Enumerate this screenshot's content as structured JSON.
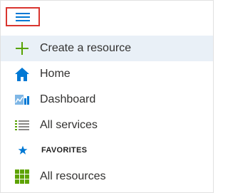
{
  "menu": {
    "toggle_icon": "hamburger-icon",
    "items": [
      {
        "label": "Create a resource",
        "icon": "plus-icon",
        "selected": true
      },
      {
        "label": "Home",
        "icon": "home-icon"
      },
      {
        "label": "Dashboard",
        "icon": "dashboard-icon"
      },
      {
        "label": "All services",
        "icon": "list-icon"
      }
    ],
    "favorites": {
      "header": "FAVORITES",
      "icon": "star-icon",
      "items": [
        {
          "label": "All resources",
          "icon": "grid-icon"
        }
      ]
    }
  },
  "colors": {
    "accent": "#0078d4",
    "plus_green": "#57a300",
    "selected_bg": "#e9f0f7",
    "highlight_border": "#d9352f",
    "grid_green": "#5ea300"
  }
}
